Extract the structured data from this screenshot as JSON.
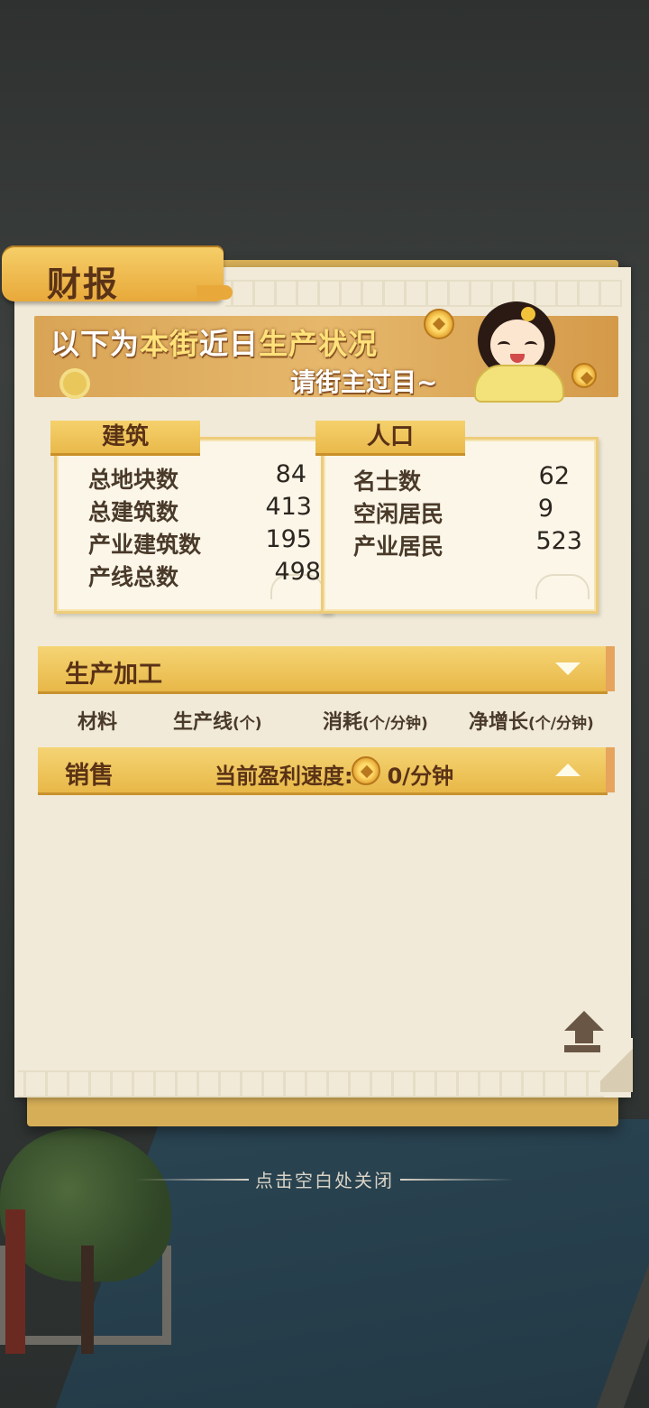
{
  "title": "财报",
  "banner": {
    "line1_a": "以下为",
    "line1_b": "本街",
    "line1_c": "近日",
    "line1_d": "生产状况",
    "line2": "请街主过目~"
  },
  "buildings": {
    "tab": "建筑",
    "rows": [
      {
        "label": "总地块数",
        "value": "84"
      },
      {
        "label": "总建筑数",
        "value": "413"
      },
      {
        "label": "产业建筑数",
        "value": "195"
      },
      {
        "label": "产线总数",
        "value": "498"
      }
    ]
  },
  "population": {
    "tab": "人口",
    "rows": [
      {
        "label": "名士数",
        "value": "62"
      },
      {
        "label": "空闲居民",
        "value": "9"
      },
      {
        "label": "产业居民",
        "value": "523"
      }
    ]
  },
  "production": {
    "title": "生产加工",
    "columns": [
      "材料",
      "生产线",
      "(个)",
      "消耗",
      "(个/分钟)",
      "净增长",
      "(个/分钟)"
    ]
  },
  "sales": {
    "title": "销售",
    "profit_label": "当前盈利速度:",
    "profit_value": "0/分钟"
  },
  "close_hint": "点击空白处关闭",
  "icons": {
    "collapse": "triangle-down-icon",
    "expand": "triangle-up-icon",
    "coin": "coin-icon",
    "scroll_top": "scroll-to-top-icon"
  },
  "colors": {
    "accent": "#e8b848",
    "title_text": "#5a3216",
    "paper": "#f1ead8",
    "highlight": "#ffe27a"
  }
}
